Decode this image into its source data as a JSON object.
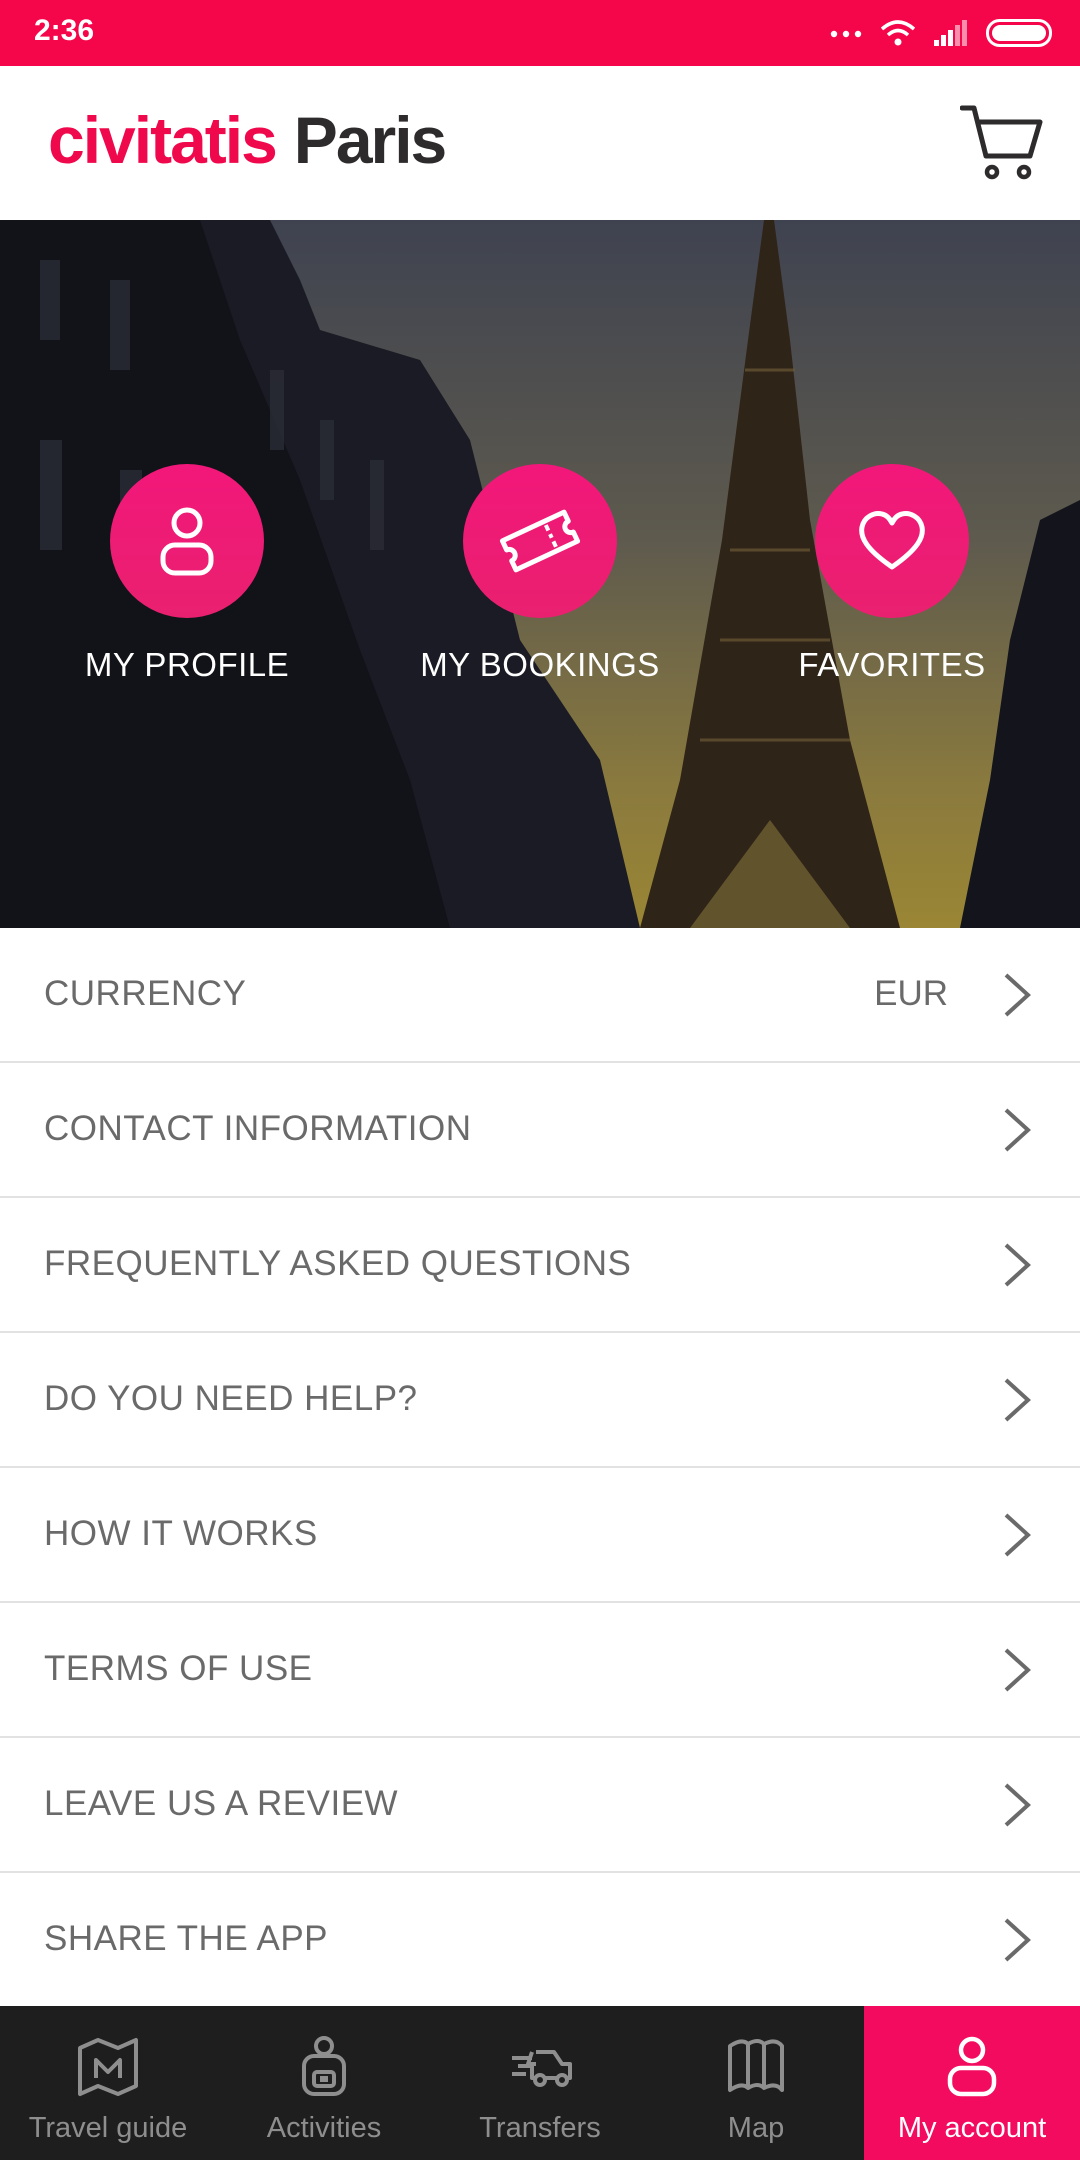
{
  "status_bar": {
    "time": "2:36"
  },
  "header": {
    "brand": "civitatis",
    "city": "Paris",
    "cart_icon": "cart-icon"
  },
  "hero": {
    "actions": [
      {
        "label": "MY PROFILE",
        "icon": "user-icon"
      },
      {
        "label": "MY BOOKINGS",
        "icon": "ticket-icon"
      },
      {
        "label": "FAVORITES",
        "icon": "heart-icon"
      }
    ]
  },
  "menu": {
    "items": [
      {
        "label": "CURRENCY",
        "value": "EUR"
      },
      {
        "label": "CONTACT INFORMATION"
      },
      {
        "label": "FREQUENTLY ASKED QUESTIONS"
      },
      {
        "label": "DO YOU NEED HELP?"
      },
      {
        "label": "HOW IT WORKS"
      },
      {
        "label": "TERMS OF USE"
      },
      {
        "label": "LEAVE US A REVIEW"
      },
      {
        "label": "SHARE THE APP"
      }
    ]
  },
  "bottom_nav": {
    "items": [
      {
        "label": "Travel guide",
        "icon": "guide-map-icon"
      },
      {
        "label": "Activities",
        "icon": "backpack-icon"
      },
      {
        "label": "Transfers",
        "icon": "car-icon"
      },
      {
        "label": "Map",
        "icon": "map-icon"
      },
      {
        "label": "My account",
        "icon": "user-icon",
        "active": true
      }
    ]
  },
  "colors": {
    "brand": "#f0084d",
    "status_bar": "#f5054a",
    "nav_active": "#f20b5f",
    "nav_bg": "#1f1e1f"
  }
}
